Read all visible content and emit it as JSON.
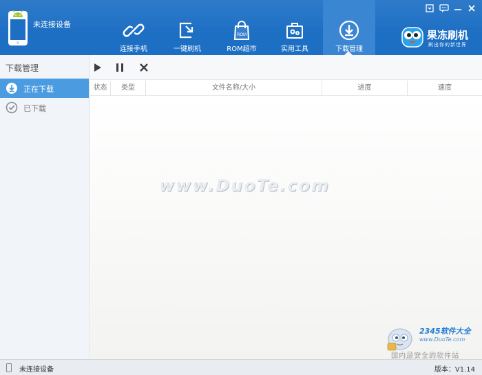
{
  "header": {
    "device_status": "未连接设备",
    "nav": [
      {
        "label": "连接手机",
        "icon": "link-icon"
      },
      {
        "label": "一键刷机",
        "icon": "flash-icon"
      },
      {
        "label": "ROM超市",
        "icon": "rom-bag-icon",
        "badge": "ROM"
      },
      {
        "label": "实用工具",
        "icon": "toolbox-icon"
      },
      {
        "label": "下载管理",
        "icon": "download-icon"
      }
    ],
    "active_nav": "下载管理",
    "brand": {
      "name": "果冻刷机",
      "slogan": "刷出你的新世界"
    },
    "window_controls": [
      "minimize-icon",
      "menu-icon",
      "close-icon"
    ]
  },
  "sidebar": {
    "title": "下载管理",
    "items": [
      {
        "label": "正在下载",
        "icon": "download-circle-icon",
        "active": true
      },
      {
        "label": "已下载",
        "icon": "check-circle-icon",
        "active": false
      }
    ]
  },
  "toolbar": {
    "buttons": [
      "play-icon",
      "pause-icon",
      "cancel-icon"
    ]
  },
  "table": {
    "columns": [
      "状态",
      "类型",
      "文件名称/大小",
      "进度",
      "速度"
    ],
    "rows": []
  },
  "watermarks": {
    "center": "www.DuoTe.com",
    "corner_brand": "2345软件大全",
    "corner_url": "www.DuoTe.com",
    "corner_slogan": "国内最安全的软件站"
  },
  "statusbar": {
    "device_status": "未连接设备",
    "version_label": "版本：V1.14"
  },
  "colors": {
    "header_bg": "#1d6fc4",
    "active_nav_bg": "#3b86d3",
    "sidebar_active_bg": "#4a9be0",
    "sidebar_bg": "#f1f4f8"
  }
}
